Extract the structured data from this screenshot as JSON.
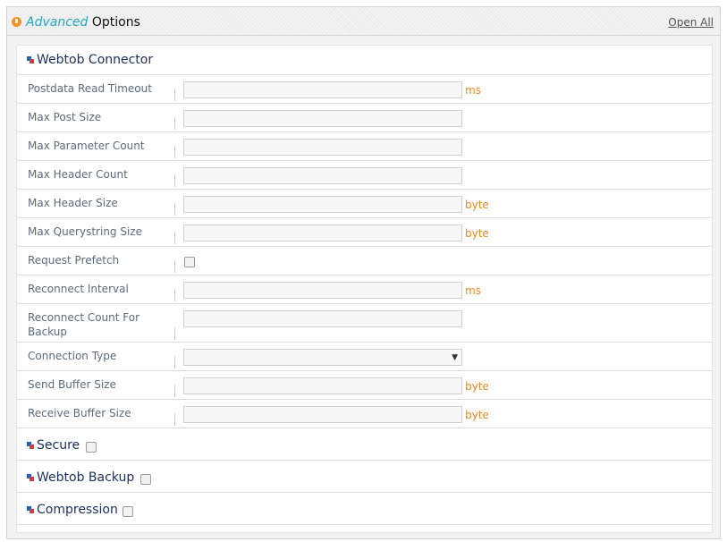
{
  "header": {
    "title_italic": "Advanced",
    "title_rest": " Options",
    "open_all": "Open All"
  },
  "sections": {
    "webtob_connector": "Webtob Connector",
    "secure": "Secure",
    "webtob_backup": "Webtob Backup",
    "compression": "Compression"
  },
  "fields": [
    {
      "label": "Postdata Read Timeout",
      "value": "",
      "unit": "ms"
    },
    {
      "label": "Max Post Size",
      "value": "",
      "unit": ""
    },
    {
      "label": "Max Parameter Count",
      "value": "",
      "unit": ""
    },
    {
      "label": "Max Header Count",
      "value": "",
      "unit": ""
    },
    {
      "label": "Max Header Size",
      "value": "",
      "unit": "byte"
    },
    {
      "label": "Max Querystring Size",
      "value": "",
      "unit": "byte"
    },
    {
      "label": "Request Prefetch",
      "checked": false
    },
    {
      "label": "Reconnect Interval",
      "value": "",
      "unit": "ms"
    },
    {
      "label": "Reconnect Count For Backup",
      "value": "",
      "unit": ""
    },
    {
      "label": "Connection Type",
      "selected": ""
    },
    {
      "label": "Send Buffer Size",
      "value": "",
      "unit": "byte"
    },
    {
      "label": "Receive Buffer Size",
      "value": "",
      "unit": "byte"
    }
  ],
  "icons": {
    "header": "info-icon",
    "section": "section-bullet-icon",
    "dropdown": "chevron-down-icon"
  },
  "colors": {
    "accent_italic": "#21a7c7",
    "unit": "#e88b1f",
    "section_title": "#1b2f5c",
    "field_label": "#5d6b7a"
  }
}
